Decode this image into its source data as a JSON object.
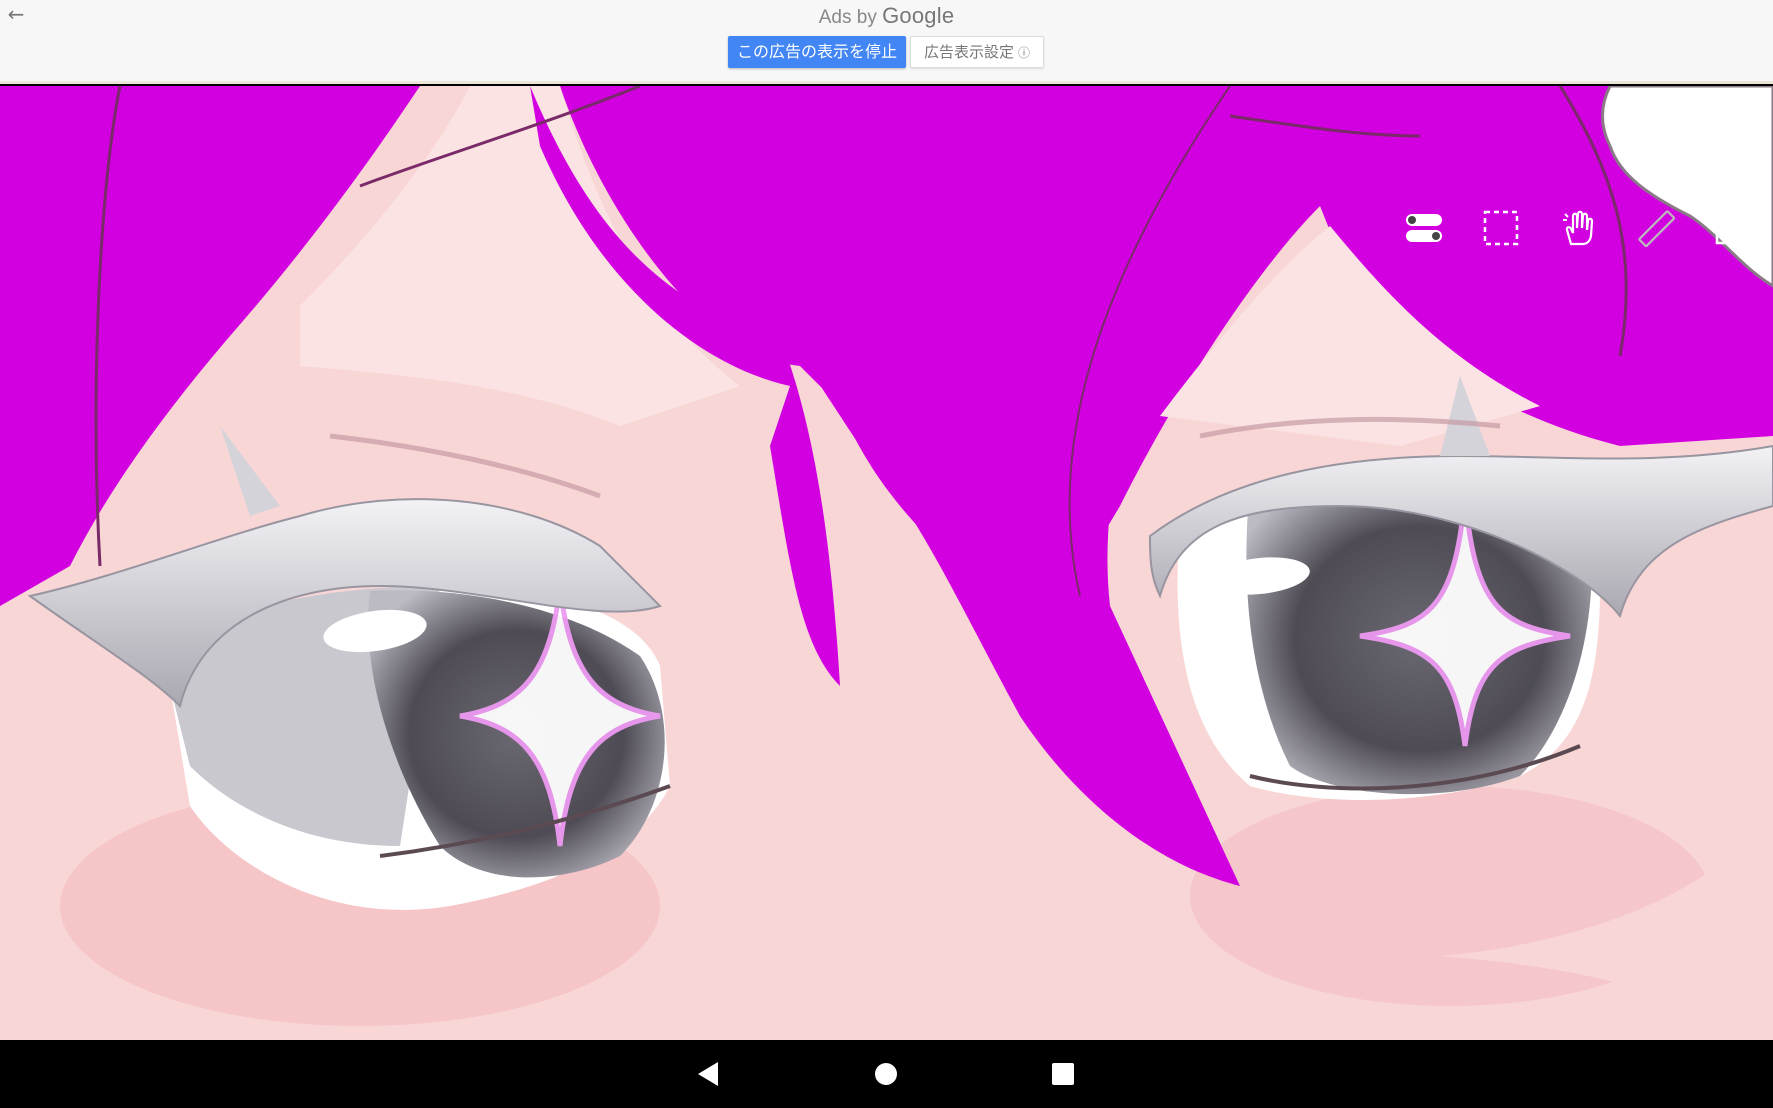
{
  "ad": {
    "ads_by": "Ads by",
    "brand": "Google",
    "stop_button": "この広告の表示を停止",
    "settings_button": "広告表示設定",
    "info_glyph": "ⓘ",
    "back_glyph": "←"
  },
  "canvas": {
    "background_color": "#d200e0",
    "skin_color": "#f9d6d6"
  },
  "top_tools": [
    {
      "name": "toggle-icon"
    },
    {
      "name": "selection-icon"
    },
    {
      "name": "hand-icon"
    },
    {
      "name": "ruler-icon"
    },
    {
      "name": "image-icon"
    }
  ],
  "bottom_tools": [
    {
      "name": "brush-eraser-swap-icon"
    },
    {
      "name": "ellipse-icon"
    },
    {
      "name": "rectangle-icon"
    },
    {
      "name": "up-arrow-icon"
    },
    {
      "name": "undo-icon"
    },
    {
      "name": "redo-icon"
    },
    {
      "name": "layers-icon"
    },
    {
      "name": "back-arrow-icon"
    }
  ],
  "nav": {
    "back": "nav-back-icon",
    "home": "nav-home-icon",
    "recents": "nav-recents-icon"
  }
}
